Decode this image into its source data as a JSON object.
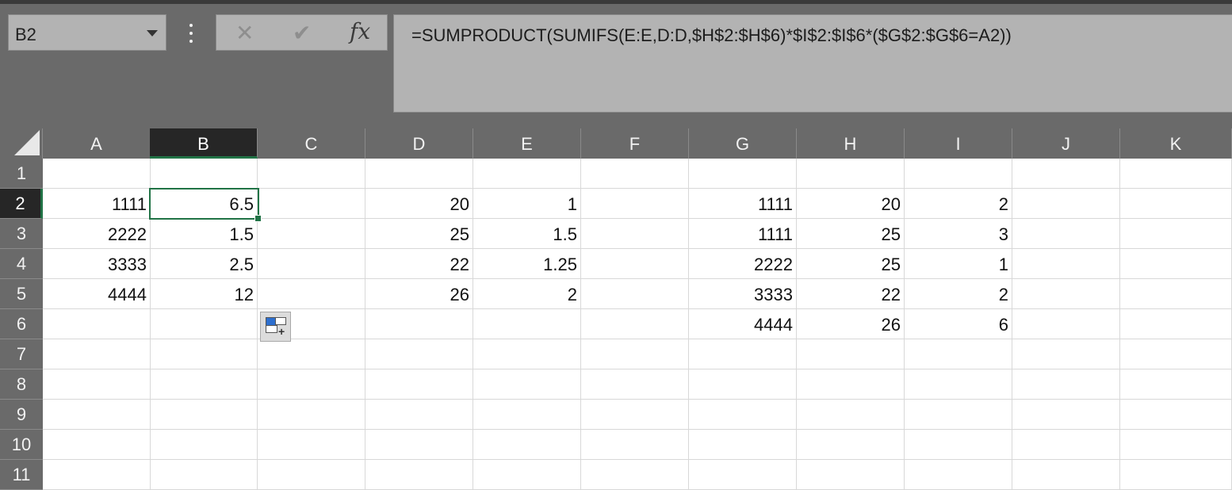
{
  "namebox": {
    "value": "B2"
  },
  "formula_bar": {
    "cancel_icon": "close-icon",
    "enter_icon": "check-icon",
    "fx_label": "fx",
    "formula": "=SUMPRODUCT(SUMIFS(E:E,D:D,$H$2:$H$6)*$I$2:$I$6*($G$2:$G$6=A2))"
  },
  "columns": [
    "A",
    "B",
    "C",
    "D",
    "E",
    "F",
    "G",
    "H",
    "I",
    "J",
    "K"
  ],
  "rows": [
    "1",
    "2",
    "3",
    "4",
    "5",
    "6",
    "7",
    "8",
    "9",
    "10",
    "11"
  ],
  "selected": {
    "column": "B",
    "row": "2"
  },
  "cells": {
    "A2": "1111",
    "B2": "6.5",
    "D2": "20",
    "E2": "1",
    "G2": "1111",
    "H2": "20",
    "I2": "2",
    "A3": "2222",
    "B3": "1.5",
    "D3": "25",
    "E3": "1.5",
    "G3": "1111",
    "H3": "25",
    "I3": "3",
    "A4": "3333",
    "B4": "2.5",
    "D4": "22",
    "E4": "1.25",
    "G4": "2222",
    "H4": "25",
    "I4": "1",
    "A5": "4444",
    "B5": "12",
    "D5": "26",
    "E5": "2",
    "G5": "3333",
    "H5": "22",
    "I5": "2",
    "G6": "4444",
    "H6": "26",
    "I6": "6"
  },
  "paste_options_icon": "paste-options-icon"
}
